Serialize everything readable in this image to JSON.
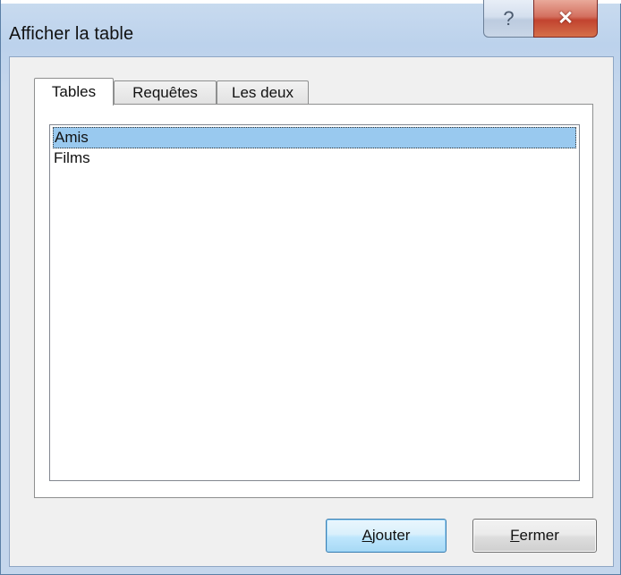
{
  "window": {
    "title": "Afficher la table",
    "help_glyph": "?",
    "close_glyph": "✕"
  },
  "tabs": [
    {
      "label": "Tables",
      "active": true
    },
    {
      "label": "Requêtes",
      "active": false
    },
    {
      "label": "Les deux",
      "active": false
    }
  ],
  "list": {
    "items": [
      {
        "label": "Amis",
        "selected": true
      },
      {
        "label": "Films",
        "selected": false
      }
    ]
  },
  "buttons": {
    "add_mnemonic": "A",
    "add_rest": "jouter",
    "close_mnemonic": "F",
    "close_rest": "ermer"
  },
  "colors": {
    "selection": "#99c9ef",
    "frame": "#c4d6ec",
    "close_button": "#c2432f"
  }
}
